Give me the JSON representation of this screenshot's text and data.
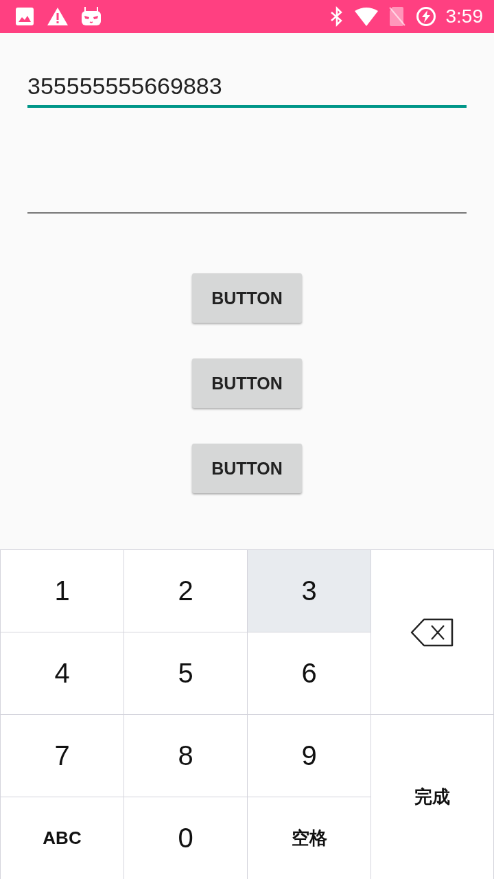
{
  "status_bar": {
    "time": "3:59"
  },
  "fields": [
    {
      "value": "355555555669883",
      "focused": true
    },
    {
      "focused": false
    }
  ],
  "buttons": [
    "BUTTON",
    "BUTTON",
    "BUTTON"
  ],
  "keyboard": {
    "keys": [
      {
        "kind": "digit",
        "label": "1",
        "selected": false
      },
      {
        "kind": "digit",
        "label": "2",
        "selected": false
      },
      {
        "kind": "digit",
        "label": "3",
        "selected": true
      },
      {
        "kind": "backspace",
        "selected": false
      },
      {
        "kind": "digit",
        "label": "4",
        "selected": false
      },
      {
        "kind": "digit",
        "label": "5",
        "selected": false
      },
      {
        "kind": "digit",
        "label": "6",
        "selected": false
      },
      {
        "kind": "digit",
        "label": "7",
        "selected": false
      },
      {
        "kind": "digit",
        "label": "8",
        "selected": false
      },
      {
        "kind": "digit",
        "label": "9",
        "selected": false
      },
      {
        "kind": "done",
        "label": "完成",
        "selected": false
      },
      {
        "kind": "text",
        "label": "ABC",
        "selected": false
      },
      {
        "kind": "digit",
        "label": "0",
        "selected": false
      },
      {
        "kind": "text",
        "label": "空格",
        "selected": false
      }
    ]
  }
}
